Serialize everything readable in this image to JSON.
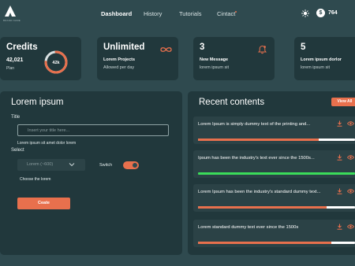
{
  "brand": {
    "logo_text": "BRAND NAME"
  },
  "nav": {
    "items": [
      {
        "label": "Dashboard",
        "active": true
      },
      {
        "label": "History",
        "active": false
      },
      {
        "label": "Tutorials",
        "active": false
      },
      {
        "label": "Cintact",
        "active": false
      }
    ],
    "coins": "764",
    "icons": {
      "theme": "sun-icon",
      "coin": "coin-icon"
    }
  },
  "cards": {
    "credits": {
      "title": "Credits",
      "value": "42,021",
      "label": "Plan",
      "ring_label": "42k",
      "ring_progress": 0.75
    },
    "unlimited": {
      "title": "Unlimited",
      "sub1": "Lorem Projects",
      "sub2": "Allowed per day",
      "icon": "infinity-icon"
    },
    "messages": {
      "title": "3",
      "sub1": "New Message",
      "sub2": "lorem ipsum sit",
      "icon": "bell-icon"
    },
    "other": {
      "title": "5",
      "sub1": "Lorem ipsum dorlor",
      "sub2": "lorem ipsum sit"
    }
  },
  "form": {
    "heading": "Lorem ipsum",
    "title_label": "Title",
    "title_placeholder": "Insert your title here...",
    "title_help": "Lorem ipsum sit amet dolor lorem",
    "select_label": "Select",
    "select_value": "Lorem  (~600)",
    "switch_label": "Switch",
    "switch_on": true,
    "choose_text": "Choose the lorem",
    "create_label": "Ceate"
  },
  "recent": {
    "heading": "Recent contents",
    "view_all": "View All",
    "items": [
      {
        "text": "Lorem Ipsum is simply dummy text of the printing and...",
        "progress": 0.77,
        "color": "#e8704d"
      },
      {
        "text": "Ipsum has been the industry's text ever since the 1500s...",
        "progress": 1.0,
        "color": "#3bdc5a"
      },
      {
        "text": "Lorem Ipsum has been the industry's standard dummy text...",
        "progress": 0.82,
        "color": "#e8704d"
      },
      {
        "text": "Lorem standard dummy text ever since the 1500s",
        "progress": 0.85,
        "color": "#e8704d"
      }
    ]
  },
  "colors": {
    "accent": "#e8704d",
    "success": "#3bdc5a",
    "background": "#2f4a4f",
    "panel": "#21383c"
  }
}
